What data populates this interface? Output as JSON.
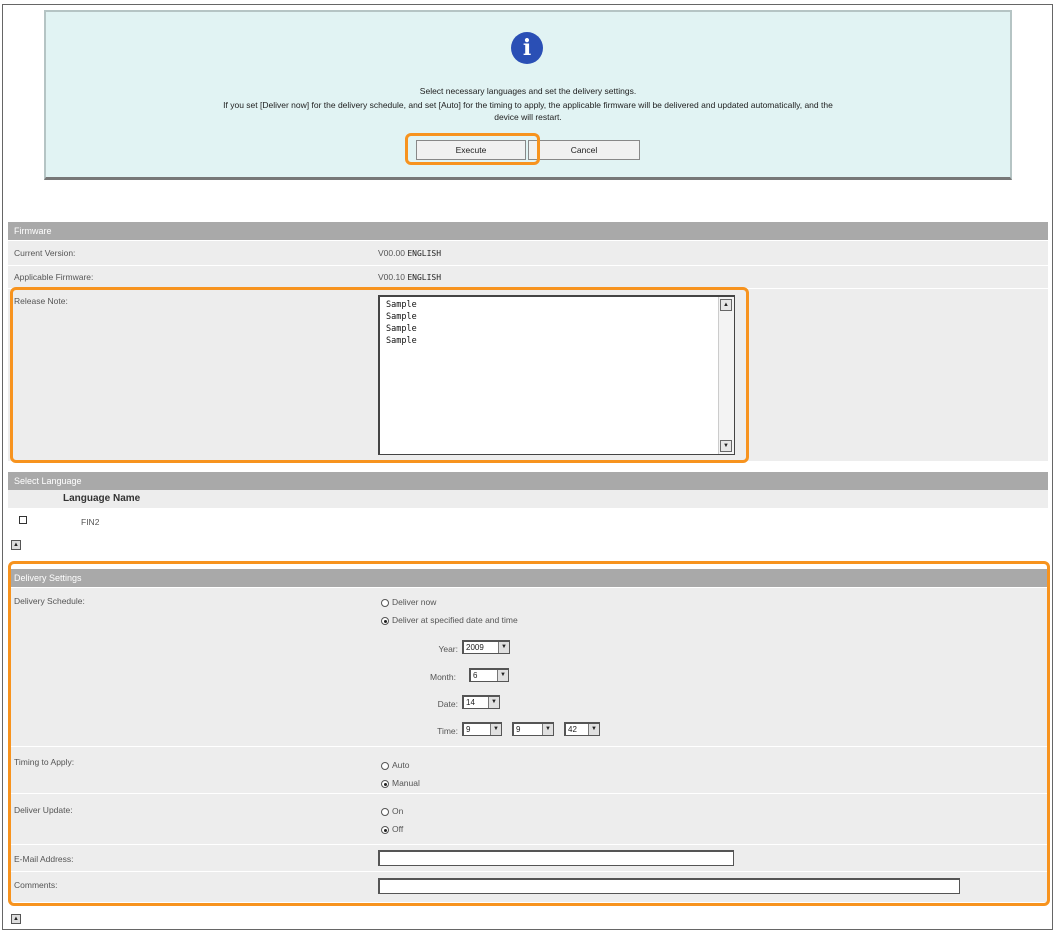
{
  "info": {
    "icon": "info-icon",
    "icon_glyph": "i",
    "line1": "Select necessary languages and set the delivery settings.",
    "line2": "If you set [Deliver now] for the delivery schedule, and set [Auto] for the timing to apply, the applicable firmware will be delivered and updated automatically, and the",
    "line3": "device will restart.",
    "execute_label": "Execute",
    "cancel_label": "Cancel"
  },
  "firmware": {
    "header": "Firmware",
    "current_version_label": "Current Version:",
    "current_version_num": "V00.00",
    "current_version_lang": "ENGLISH",
    "applicable_label": "Applicable Firmware:",
    "applicable_num": "V00.10",
    "applicable_lang": "ENGLISH",
    "release_note_label": "Release Note:",
    "release_note_lines": [
      "Sample",
      "Sample",
      "Sample",
      "Sample"
    ]
  },
  "language": {
    "header": "Select Language",
    "column_header": "Language Name",
    "items": [
      {
        "name": "FIN2",
        "checked": false
      }
    ]
  },
  "delivery": {
    "header": "Delivery Settings",
    "schedule_label": "Delivery Schedule:",
    "deliver_now_label": "Deliver now",
    "deliver_specified_label": "Deliver at specified date and time",
    "schedule_selected": "specified",
    "year_label": "Year:",
    "year_value": "2009",
    "month_label": "Month:",
    "month_value": "6",
    "date_label": "Date:",
    "date_value": "14",
    "time_label": "Time:",
    "hour_value": "9",
    "minute_value": "9",
    "second_value": "42",
    "timing_label": "Timing to Apply:",
    "auto_label": "Auto",
    "manual_label": "Manual",
    "timing_selected": "manual",
    "deliver_update_label": "Deliver Update:",
    "on_label": "On",
    "off_label": "Off",
    "update_selected": "off",
    "email_label": "E-Mail Address:",
    "email_value": "",
    "comments_label": "Comments:",
    "comments_value": ""
  },
  "colors": {
    "highlight": "#f7931e",
    "section_header": "#a9a9a9",
    "info_bg": "#e1f3f3",
    "row_bg": "#ededed"
  }
}
